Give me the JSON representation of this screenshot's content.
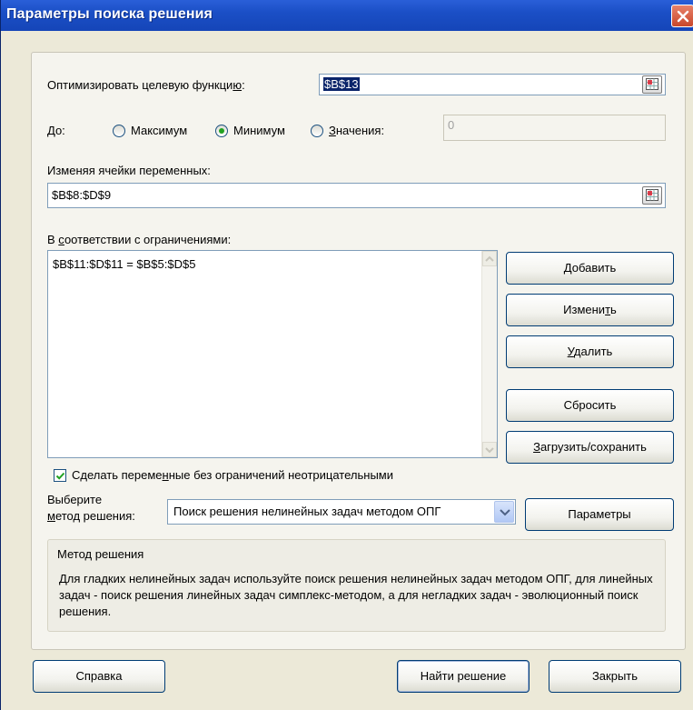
{
  "window": {
    "title": "Параметры поиска решения"
  },
  "objective": {
    "label": "Оптимизировать целевую функцию:",
    "label_prefix": "Оптимизировать целевую функци",
    "label_u": "ю",
    "label_suffix": ":",
    "value": "$B$13"
  },
  "to": {
    "label": "До:",
    "options": [
      {
        "label": "Максимум",
        "selected": false
      },
      {
        "label": "Минимум",
        "selected": true
      },
      {
        "label": "Значения:",
        "u": "З",
        "rest": "начения:",
        "selected": false
      }
    ],
    "value_input": "0"
  },
  "variables": {
    "label": "Изменяя ячейки переменных:",
    "value": "$B$8:$D$9"
  },
  "constraints": {
    "label": "В соответствии с ограничениями:",
    "label_u": "с",
    "label_pre": "В ",
    "label_post": "оответствии с ограничениями:",
    "items": [
      "$B$11:$D$11 = $B$5:$D$5"
    ]
  },
  "buttons": {
    "add": {
      "label": "Добавить",
      "u": "Д",
      "rest": "обавить"
    },
    "change": {
      "label": "Изменить",
      "pre": "Измени",
      "u": "т",
      "post": "ь"
    },
    "delete": {
      "label": "Удалить",
      "u": "У",
      "rest": "далить"
    },
    "reset": {
      "label": "Сбросить"
    },
    "load_save": {
      "label": "Загрузить/сохранить",
      "u": "З",
      "rest": "агрузить/сохранить"
    },
    "options": {
      "label": "Параметры"
    },
    "help": {
      "label": "Справка"
    },
    "solve": {
      "label": "Найти решение"
    },
    "close": {
      "label": "Закрыть"
    }
  },
  "nonneg": {
    "checked": true,
    "label": "Сделать переменные без ограничений неотрицательными",
    "pre": "Сделать переме",
    "u": "н",
    "post": "ные без ограничений неотрицательными"
  },
  "method": {
    "label_line1": "Выберите",
    "label_line2": "метод решения:",
    "label_u": "м",
    "label_line2_rest": "етод решения:",
    "value": "Поиск решения нелинейных задач методом ОПГ"
  },
  "method_info": {
    "title": "Метод решения",
    "text": "Для гладких нелинейных задач используйте поиск решения нелинейных задач методом ОПГ, для линейных задач - поиск решения линейных задач симплекс-методом, а для негладких задач - эволюционный поиск решения."
  },
  "colors": {
    "titlebar": "#1b4fc6",
    "dialog_bg": "#ece9d8",
    "selection": "#0a246a"
  }
}
